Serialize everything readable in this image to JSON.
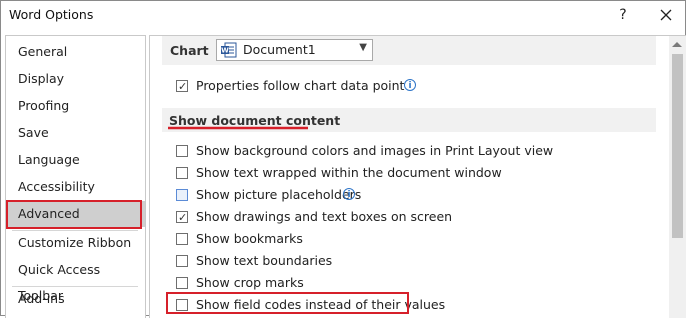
{
  "window": {
    "title": "Word Options",
    "help": "?"
  },
  "sidebar": {
    "items": [
      {
        "label": "General"
      },
      {
        "label": "Display"
      },
      {
        "label": "Proofing"
      },
      {
        "label": "Save"
      },
      {
        "label": "Language"
      },
      {
        "label": "Accessibility"
      },
      {
        "label": "Advanced"
      },
      {
        "label": "Customize Ribbon"
      },
      {
        "label": "Quick Access Toolbar"
      },
      {
        "label": "Add-ins"
      }
    ],
    "selected": "Advanced"
  },
  "chart": {
    "label": "Chart",
    "document": "Document1",
    "option": {
      "label": "Properties follow chart data point",
      "checked": true
    }
  },
  "section": {
    "title": "Show document content",
    "options": [
      {
        "label": "Show background colors and images in Print Layout view",
        "checked": false
      },
      {
        "label": "Show text wrapped within the document window",
        "checked": false
      },
      {
        "label": "Show picture placeholders",
        "checked": false
      },
      {
        "label": "Show drawings and text boxes on screen",
        "checked": true
      },
      {
        "label": "Show bookmarks",
        "checked": false
      },
      {
        "label": "Show text boundaries",
        "checked": false
      },
      {
        "label": "Show crop marks",
        "checked": false
      },
      {
        "label": "Show field codes instead of their values",
        "checked": false
      }
    ]
  },
  "colors": {
    "highlight": "#d6202a",
    "selected_bg": "#cfcfcf",
    "info_blue": "#2f75c8"
  }
}
